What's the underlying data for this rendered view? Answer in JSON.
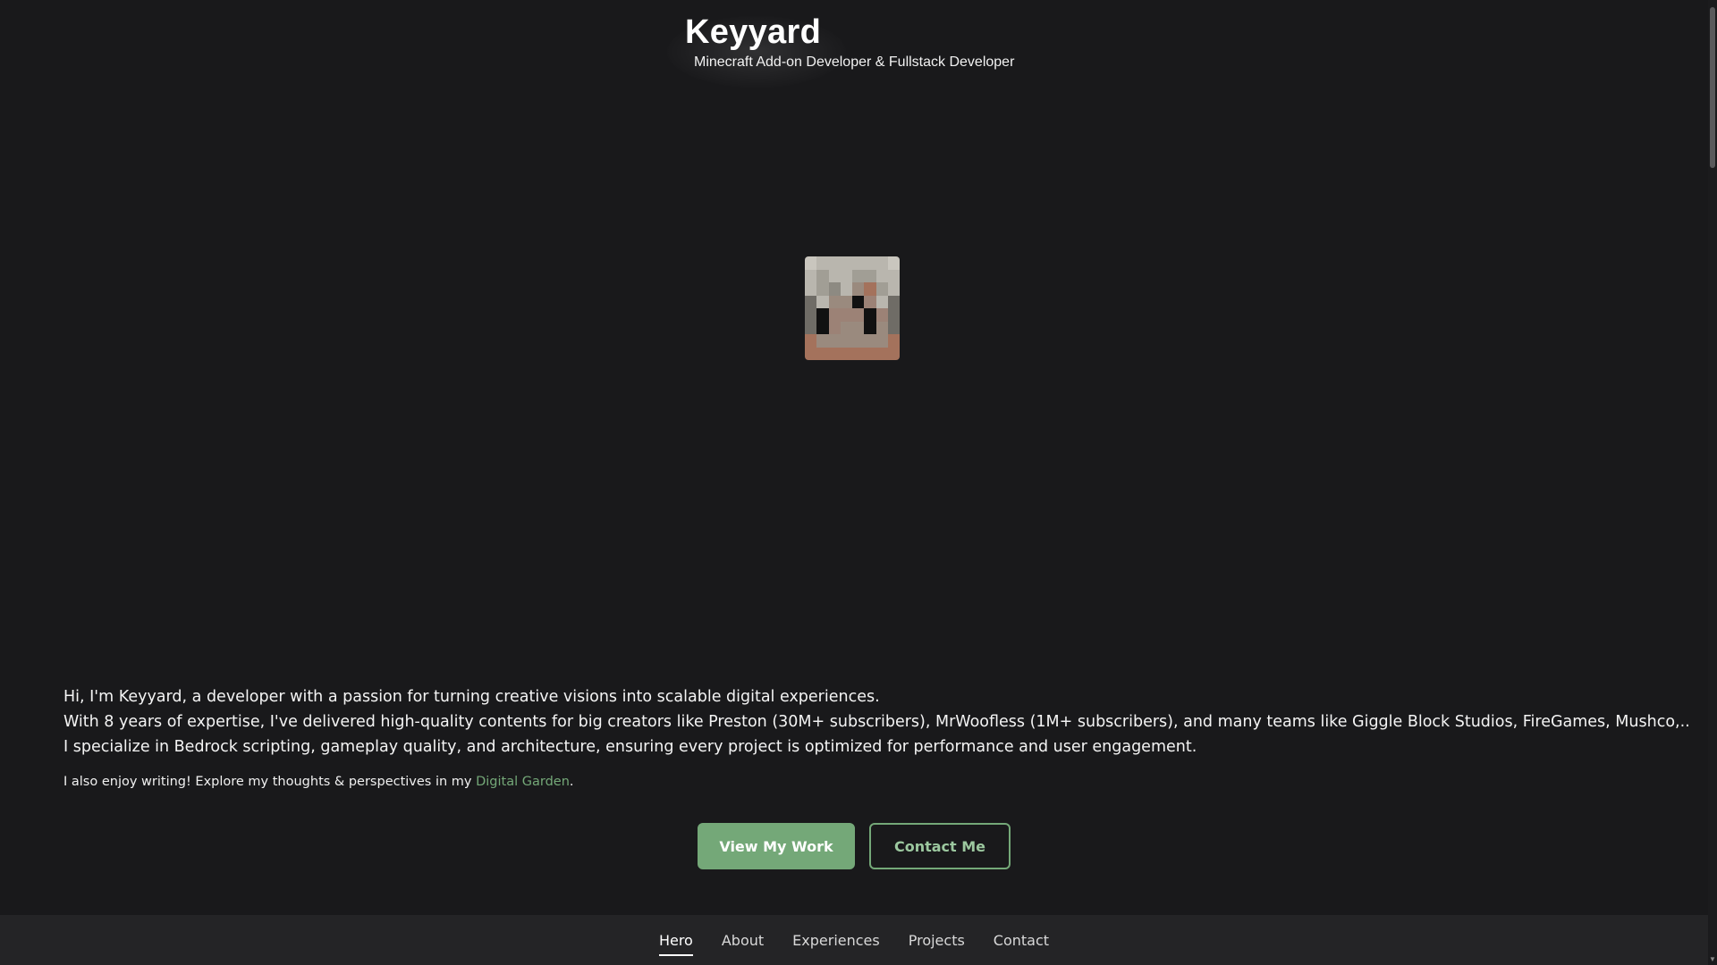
{
  "header": {
    "title": "Keyyard",
    "subtitle": "Minecraft Add-on Developer & Fullstack Developer"
  },
  "intro": {
    "line1": "Hi, I'm Keyyard, a developer with a passion for turning creative visions into scalable digital experiences.",
    "line2": "With 8 years of expertise, I've delivered high-quality contents for big creators like Preston (30M+ subscribers), MrWoofless (1M+ subscribers), and many teams like Giggle Block Studios, FireGames, Mushco,..",
    "line3": "I specialize in Bedrock scripting, gameplay quality, and architecture, ensuring every project is optimized for performance and user engagement.",
    "writing_prefix": "I also enjoy writing! Explore my thoughts & perspectives in my ",
    "writing_link": "Digital Garden",
    "writing_suffix": "."
  },
  "buttons": {
    "view_work": "View My Work",
    "contact": "Contact Me"
  },
  "nav": {
    "active": "Hero",
    "items": [
      "Hero",
      "About",
      "Experiences",
      "Projects",
      "Contact"
    ]
  },
  "colors": {
    "background": "#19191b",
    "accent": "#74a878",
    "nav_background": "#242426"
  }
}
